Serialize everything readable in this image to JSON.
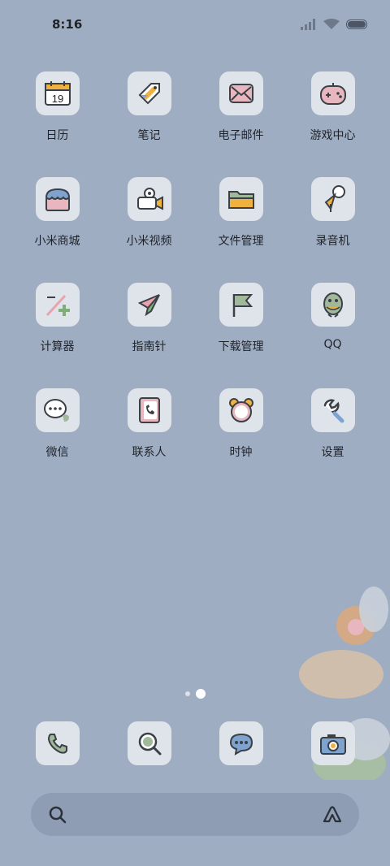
{
  "status_bar": {
    "time": "8:16"
  },
  "apps": [
    {
      "label": "日历",
      "icon": "calendar-icon",
      "date": "19"
    },
    {
      "label": "笔记",
      "icon": "notes-tag-icon"
    },
    {
      "label": "电子邮件",
      "icon": "email-icon"
    },
    {
      "label": "游戏中心",
      "icon": "game-center-icon"
    },
    {
      "label": "小米商城",
      "icon": "mi-store-icon"
    },
    {
      "label": "小米视频",
      "icon": "mi-video-icon"
    },
    {
      "label": "文件管理",
      "icon": "file-manager-icon"
    },
    {
      "label": "录音机",
      "icon": "recorder-icon"
    },
    {
      "label": "计算器",
      "icon": "calculator-icon"
    },
    {
      "label": "指南针",
      "icon": "compass-icon"
    },
    {
      "label": "下载管理",
      "icon": "download-flag-icon"
    },
    {
      "label": "QQ",
      "icon": "qq-penguin-icon"
    },
    {
      "label": "微信",
      "icon": "wechat-icon"
    },
    {
      "label": "联系人",
      "icon": "contacts-icon"
    },
    {
      "label": "时钟",
      "icon": "alarm-clock-icon"
    },
    {
      "label": "设置",
      "icon": "wrench-settings-icon"
    }
  ],
  "dock": [
    {
      "icon": "phone-icon"
    },
    {
      "icon": "browser-search-icon"
    },
    {
      "icon": "messages-icon"
    },
    {
      "icon": "camera-icon"
    }
  ],
  "page_indicator": {
    "pages": 2,
    "current": 2
  },
  "colors": {
    "background": "#9fadc2",
    "tile": "#dfe3ea",
    "search_bar": "#8e9db4"
  }
}
